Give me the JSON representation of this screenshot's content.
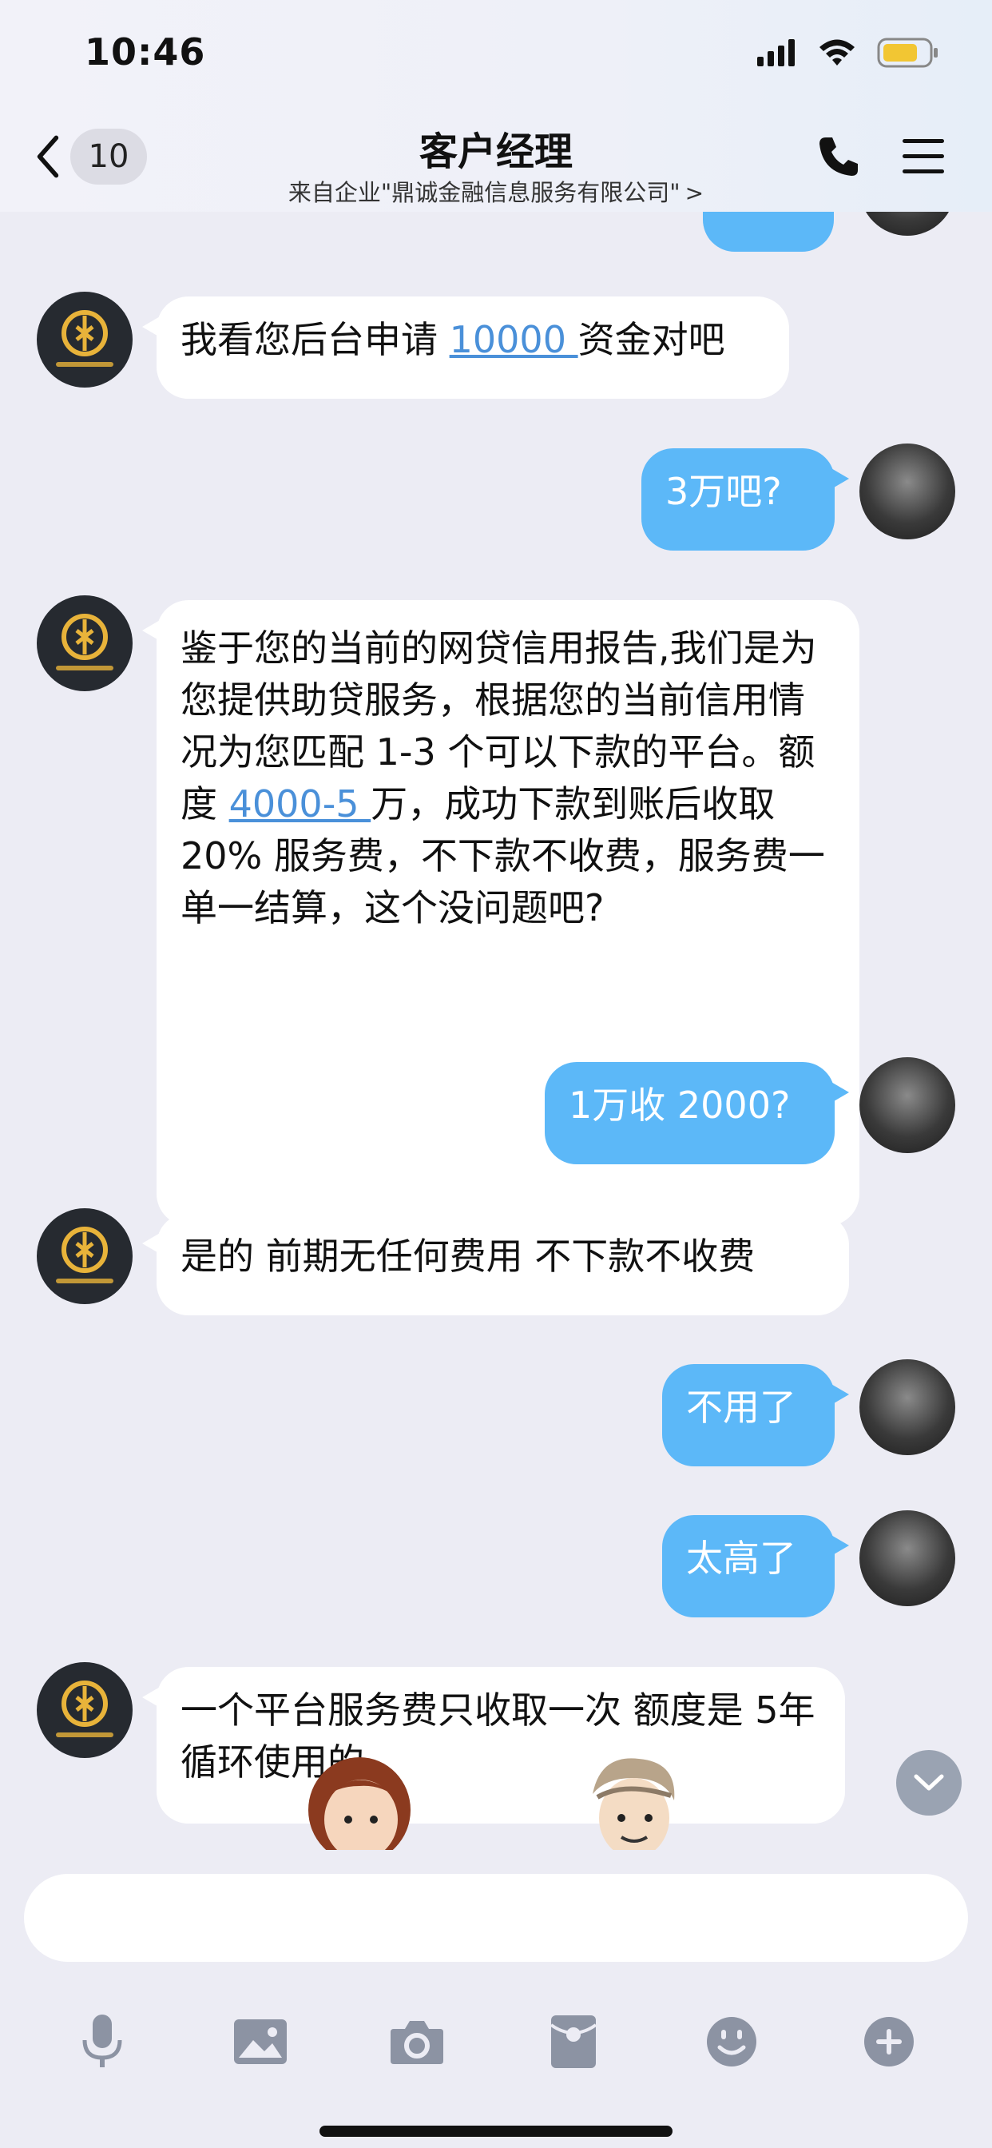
{
  "status_bar": {
    "time": "10:46"
  },
  "header": {
    "back_count": "10",
    "title": "客户经理",
    "subtitle": "来自企业\"鼎诚金融信息服务有限公司\"",
    "subtitle_chevron": ">"
  },
  "messages": [
    {
      "side": "left",
      "parts": [
        "我看您后台申请 ",
        "10000 ",
        "资金对吧"
      ]
    },
    {
      "side": "right",
      "text": "3万吧?"
    },
    {
      "side": "left",
      "parts": [
        "鉴于您的当前的网贷信用报告,我们是为您提供助贷服务，根据您的当前信用情况为您匹配 1-3 个可以下款的平台。额度 ",
        "4000-5 ",
        "万，成功下款到账后收取 20% 服务费，不下款不收费，服务费一单一结算，这个没问题吧?"
      ]
    },
    {
      "side": "right",
      "text": "1万收 2000?"
    },
    {
      "side": "left",
      "text": "是的 前期无任何费用 不下款不收费"
    },
    {
      "side": "right",
      "text": "不用了"
    },
    {
      "side": "right",
      "text": "太高了"
    },
    {
      "side": "left",
      "text": "一个平台服务费只收取一次 额度是 5年循环使用的"
    }
  ],
  "colors": {
    "bubble_right": "#5cb8f8",
    "bubble_left": "#ffffff",
    "background": "#ececf4",
    "link": "#4a90d9"
  },
  "toolbar": [
    "microphone-icon",
    "image-icon",
    "camera-icon",
    "red-packet-icon",
    "emoji-icon",
    "plus-icon"
  ]
}
